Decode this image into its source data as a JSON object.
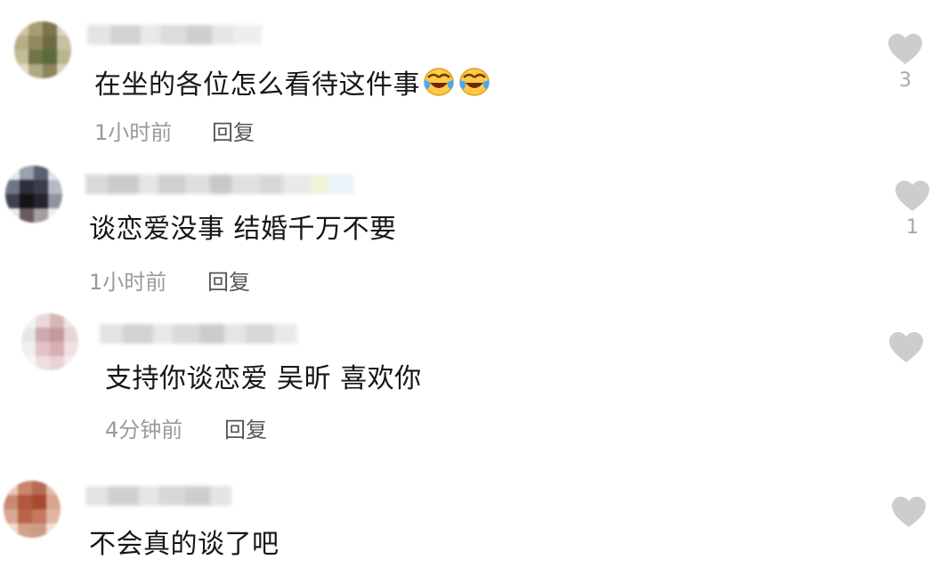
{
  "comments": [
    {
      "text": "在坐的各位怎么看待这件事",
      "emojis": [
        "laugh-cry-emoji",
        "laugh-cry-emoji"
      ],
      "time": "1小时前",
      "reply_label": "回复",
      "likes": "3",
      "avatar_colors": [
        "#cfc6a6",
        "#a89c72",
        "#7d7450",
        "#d9d4c0",
        "#b7ad86",
        "#8f8a5e",
        "#6e6a44",
        "#c9c0a0",
        "#c4bc98",
        "#6f7548",
        "#5b6a3a",
        "#b9b48f",
        "#e0dccb",
        "#b0a880",
        "#8d855e",
        "#d7d2bd"
      ],
      "name_blocks": [
        "#e4e4e4",
        "#d2d2d2",
        "#e9e9e9",
        "#dcdcdc",
        "#cfcfcf",
        "#e6e6e6",
        "#eeeeee"
      ]
    },
    {
      "text": "谈恋爱没事 结婚千万不要",
      "emojis": [],
      "time": "1小时前",
      "reply_label": "回复",
      "likes": "1",
      "avatar_colors": [
        "#e6e8ec",
        "#9aa0ad",
        "#5b6073",
        "#dfe2e8",
        "#6f7588",
        "#2c2f3b",
        "#3a3d4a",
        "#b6bac6",
        "#3e4150",
        "#141418",
        "#23242c",
        "#9094a2",
        "#e8eaee",
        "#6e5a5c",
        "#a49ea2",
        "#eceef1"
      ],
      "name_blocks": [
        "#d9d9d9",
        "#cbcbcb",
        "#e6e6e6",
        "#d0d0d0",
        "#dedede",
        "#c8c8c8",
        "#e0e0e0",
        "#d7d7d7",
        "#e9e9e9",
        "#eef3d8",
        "#eaf3fb"
      ]
    },
    {
      "text": "支持你谈恋爱 吴昕 喜欢你",
      "emojis": [],
      "time": "4分钟前",
      "reply_label": "回复",
      "likes": "",
      "avatar_colors": [
        "#f2f2f2",
        "#ead8da",
        "#d8b7b9",
        "#f0e6e7",
        "#e6e6e6",
        "#cfa9ac",
        "#c59a9f",
        "#e9d5d7",
        "#efefef",
        "#e2c3c6",
        "#d7b0b4",
        "#f0e0e2",
        "#f6f6f6",
        "#ecdfe0",
        "#e7d3d5",
        "#f5eeef"
      ],
      "name_blocks": [
        "#e3e3e3",
        "#d3d3d3",
        "#e8e8e8",
        "#dadada",
        "#cccccc",
        "#e5e5e5",
        "#d8d8d8",
        "#e9e9e9"
      ]
    },
    {
      "text": "不会真的谈了吧",
      "emojis": [],
      "time": "",
      "reply_label": "",
      "likes": "",
      "avatar_colors": [
        "#e8c9b8",
        "#c9866a",
        "#b86b52",
        "#e2b8a4",
        "#c98a72",
        "#b2583c",
        "#a44a30",
        "#d8a48e",
        "#d9a892",
        "#b8644a",
        "#c47860",
        "#e0b6a2",
        "#efdcd2",
        "#d4a08a",
        "#cf9a84",
        "#f0e0d8"
      ],
      "name_blocks": [
        "#e2e2e2",
        "#d0d0d0",
        "#e6e6e6",
        "#d8d8d8",
        "#cdcdcd",
        "#e4e4e4"
      ]
    }
  ],
  "colors": {
    "heart": "#cdcdcd",
    "text": "#161616",
    "meta": "#9a9a9a",
    "reply": "#555555",
    "emoji_face": "#ffc94a",
    "emoji_tear": "#4aa8f0"
  }
}
